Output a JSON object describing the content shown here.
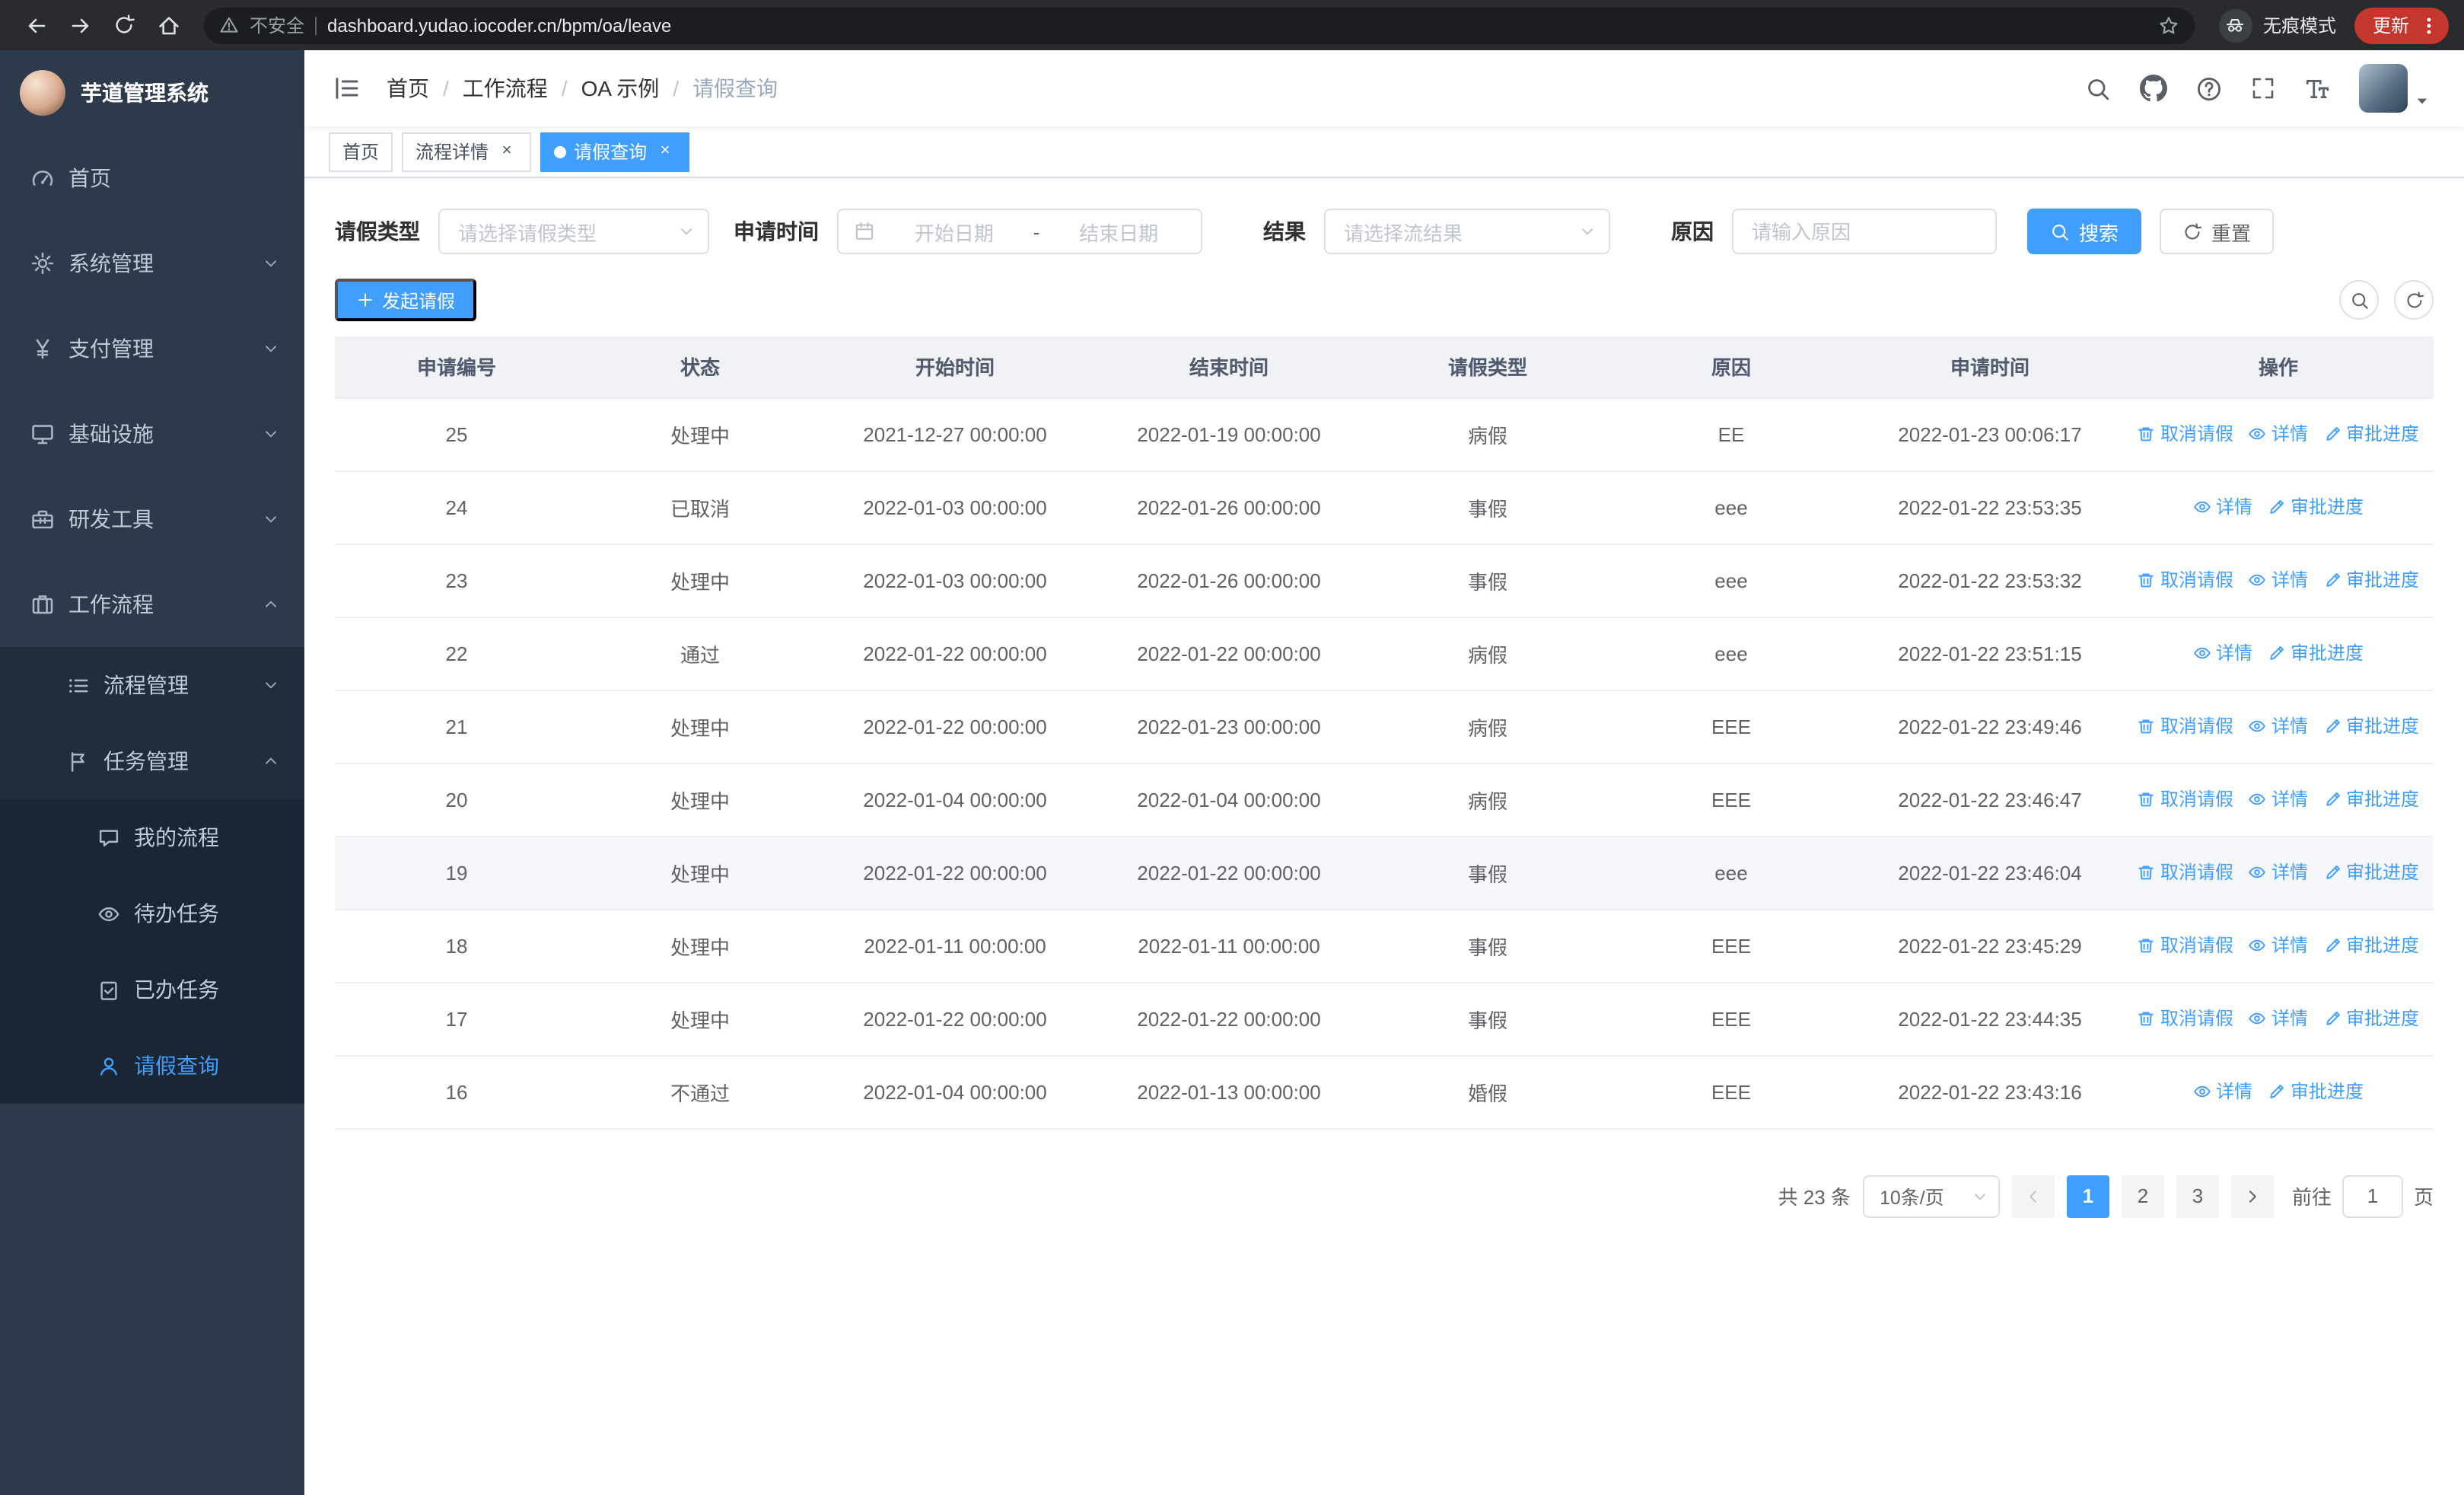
{
  "browser": {
    "security_label": "不安全",
    "url": "dashboard.yudao.iocoder.cn/bpm/oa/leave",
    "incognito_label": "无痕模式",
    "update_label": "更新"
  },
  "sidebar": {
    "app_title": "芋道管理系统",
    "items": [
      {
        "label": "首页"
      },
      {
        "label": "系统管理"
      },
      {
        "label": "支付管理"
      },
      {
        "label": "基础设施"
      },
      {
        "label": "研发工具"
      },
      {
        "label": "工作流程"
      },
      {
        "label": "流程管理"
      },
      {
        "label": "任务管理"
      },
      {
        "label": "我的流程"
      },
      {
        "label": "待办任务"
      },
      {
        "label": "已办任务"
      },
      {
        "label": "请假查询"
      }
    ]
  },
  "navbar": {
    "breadcrumb": [
      "首页",
      "工作流程",
      "OA 示例",
      "请假查询"
    ]
  },
  "tabs": [
    {
      "label": "首页"
    },
    {
      "label": "流程详情"
    },
    {
      "label": "请假查询"
    }
  ],
  "filters": {
    "leave_type_label": "请假类型",
    "leave_type_placeholder": "请选择请假类型",
    "apply_time_label": "申请时间",
    "start_date_placeholder": "开始日期",
    "range_separator": "-",
    "end_date_placeholder": "结束日期",
    "result_label": "结果",
    "result_placeholder": "请选择流结果",
    "reason_label": "原因",
    "reason_placeholder": "请输入原因",
    "search_label": "搜索",
    "reset_label": "重置"
  },
  "toolbar": {
    "create_label": "发起请假"
  },
  "table": {
    "columns": [
      "申请编号",
      "状态",
      "开始时间",
      "结束时间",
      "请假类型",
      "原因",
      "申请时间",
      "操作"
    ],
    "action_labels": {
      "cancel": "取消请假",
      "detail": "详情",
      "progress": "审批进度"
    },
    "rows": [
      {
        "id": "25",
        "status": "处理中",
        "start": "2021-12-27 00:00:00",
        "end": "2022-01-19 00:00:00",
        "type": "病假",
        "reason": "EE",
        "apply_time": "2022-01-23 00:06:17",
        "actions": [
          "cancel",
          "detail",
          "progress"
        ],
        "highlighted": false
      },
      {
        "id": "24",
        "status": "已取消",
        "start": "2022-01-03 00:00:00",
        "end": "2022-01-26 00:00:00",
        "type": "事假",
        "reason": "eee",
        "apply_time": "2022-01-22 23:53:35",
        "actions": [
          "detail",
          "progress"
        ],
        "highlighted": false
      },
      {
        "id": "23",
        "status": "处理中",
        "start": "2022-01-03 00:00:00",
        "end": "2022-01-26 00:00:00",
        "type": "事假",
        "reason": "eee",
        "apply_time": "2022-01-22 23:53:32",
        "actions": [
          "cancel",
          "detail",
          "progress"
        ],
        "highlighted": false
      },
      {
        "id": "22",
        "status": "通过",
        "start": "2022-01-22 00:00:00",
        "end": "2022-01-22 00:00:00",
        "type": "病假",
        "reason": "eee",
        "apply_time": "2022-01-22 23:51:15",
        "actions": [
          "detail",
          "progress"
        ],
        "highlighted": false
      },
      {
        "id": "21",
        "status": "处理中",
        "start": "2022-01-22 00:00:00",
        "end": "2022-01-23 00:00:00",
        "type": "病假",
        "reason": "EEE",
        "apply_time": "2022-01-22 23:49:46",
        "actions": [
          "cancel",
          "detail",
          "progress"
        ],
        "highlighted": false
      },
      {
        "id": "20",
        "status": "处理中",
        "start": "2022-01-04 00:00:00",
        "end": "2022-01-04 00:00:00",
        "type": "病假",
        "reason": "EEE",
        "apply_time": "2022-01-22 23:46:47",
        "actions": [
          "cancel",
          "detail",
          "progress"
        ],
        "highlighted": false
      },
      {
        "id": "19",
        "status": "处理中",
        "start": "2022-01-22 00:00:00",
        "end": "2022-01-22 00:00:00",
        "type": "事假",
        "reason": "eee",
        "apply_time": "2022-01-22 23:46:04",
        "actions": [
          "cancel",
          "detail",
          "progress"
        ],
        "highlighted": true
      },
      {
        "id": "18",
        "status": "处理中",
        "start": "2022-01-11 00:00:00",
        "end": "2022-01-11 00:00:00",
        "type": "事假",
        "reason": "EEE",
        "apply_time": "2022-01-22 23:45:29",
        "actions": [
          "cancel",
          "detail",
          "progress"
        ],
        "highlighted": false
      },
      {
        "id": "17",
        "status": "处理中",
        "start": "2022-01-22 00:00:00",
        "end": "2022-01-22 00:00:00",
        "type": "事假",
        "reason": "EEE",
        "apply_time": "2022-01-22 23:44:35",
        "actions": [
          "cancel",
          "detail",
          "progress"
        ],
        "highlighted": false
      },
      {
        "id": "16",
        "status": "不通过",
        "start": "2022-01-04 00:00:00",
        "end": "2022-01-13 00:00:00",
        "type": "婚假",
        "reason": "EEE",
        "apply_time": "2022-01-22 23:43:16",
        "actions": [
          "detail",
          "progress"
        ],
        "highlighted": false
      }
    ]
  },
  "pagination": {
    "total_text": "共 23 条",
    "page_size": "10条/页",
    "pages": [
      "1",
      "2",
      "3"
    ],
    "active_page": "1",
    "goto_prefix": "前往",
    "goto_value": "1",
    "goto_suffix": "页"
  },
  "colors": {
    "primary": "#409eff",
    "sidebar_bg": "#2d3a4b",
    "sidebar_sub_bg": "#222d3c",
    "table_header_bg": "#f0f2f5",
    "update_pill": "#c5372c"
  }
}
